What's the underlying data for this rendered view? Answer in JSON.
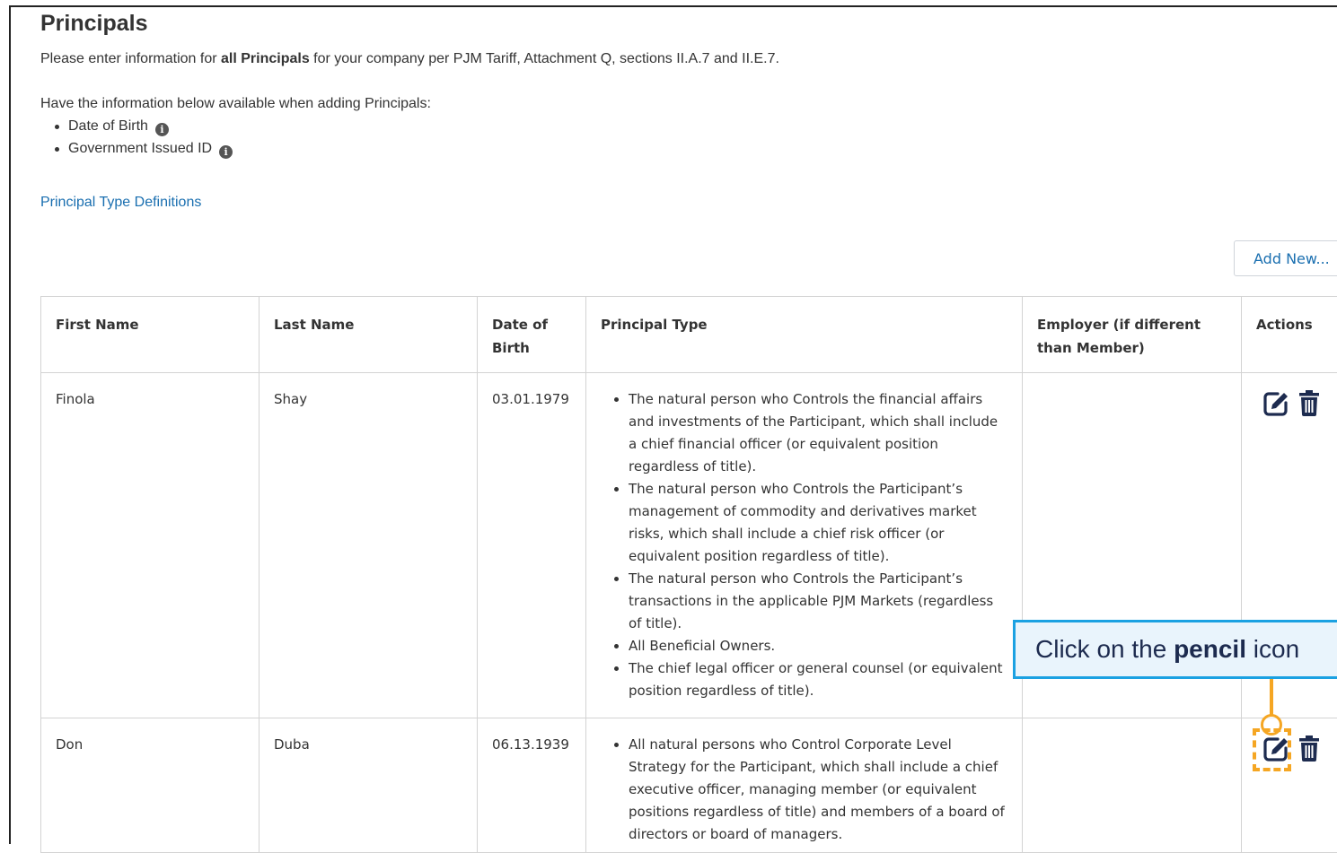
{
  "page": {
    "title": "Principals",
    "intro": {
      "before": "Please enter information for ",
      "bold": "all Principals",
      "after": " for your company per PJM Tariff, Attachment Q, sections II.A.7 and II.E.7."
    },
    "available_text": "Have the information below available when adding Principals:",
    "requirements": [
      "Date of Birth",
      "Government Issued ID"
    ],
    "definitions_link": "Principal Type Definitions",
    "add_button": "Add New..."
  },
  "table": {
    "headers": {
      "first_name": "First Name",
      "last_name": "Last Name",
      "dob": "Date of Birth",
      "principal_type": "Principal Type",
      "employer": "Employer (if different than Member)",
      "actions": "Actions"
    },
    "rows": [
      {
        "first_name": "Finola",
        "last_name": "Shay",
        "dob": "03.01.1979",
        "principal_types": [
          "The natural person who Controls the financial affairs and investments of the Participant, which shall include a chief financial officer (or equivalent position regardless of title).",
          "The natural person who Controls the Participant’s management of commodity and derivatives market risks, which shall include a chief risk officer (or equivalent position regardless of title).",
          "The natural person who Controls the Participant’s transactions in the applicable PJM Markets (regardless of title).",
          "All Beneficial Owners.",
          "The chief legal officer or general counsel (or equivalent position regardless of title)."
        ],
        "employer": ""
      },
      {
        "first_name": "Don",
        "last_name": "Duba",
        "dob": "06.13.1939",
        "principal_types": [
          "All natural persons who Control Corporate Level Strategy for the Participant, which shall include a chief executive officer, managing member (or equivalent positions regardless of title) and members of a board of directors or board of managers."
        ],
        "employer": ""
      }
    ]
  },
  "callout": {
    "before": "Click on the ",
    "bold": "pencil",
    "after": " icon"
  },
  "colors": {
    "link": "#1a6fb0",
    "callout_border": "#1ba1e2",
    "callout_bg": "#e9f4fc",
    "highlight": "#f5a623",
    "icon": "#1d2b4f"
  },
  "icons": {
    "info": "info-circle-icon",
    "edit": "pencil-square-icon",
    "delete": "trash-icon"
  }
}
